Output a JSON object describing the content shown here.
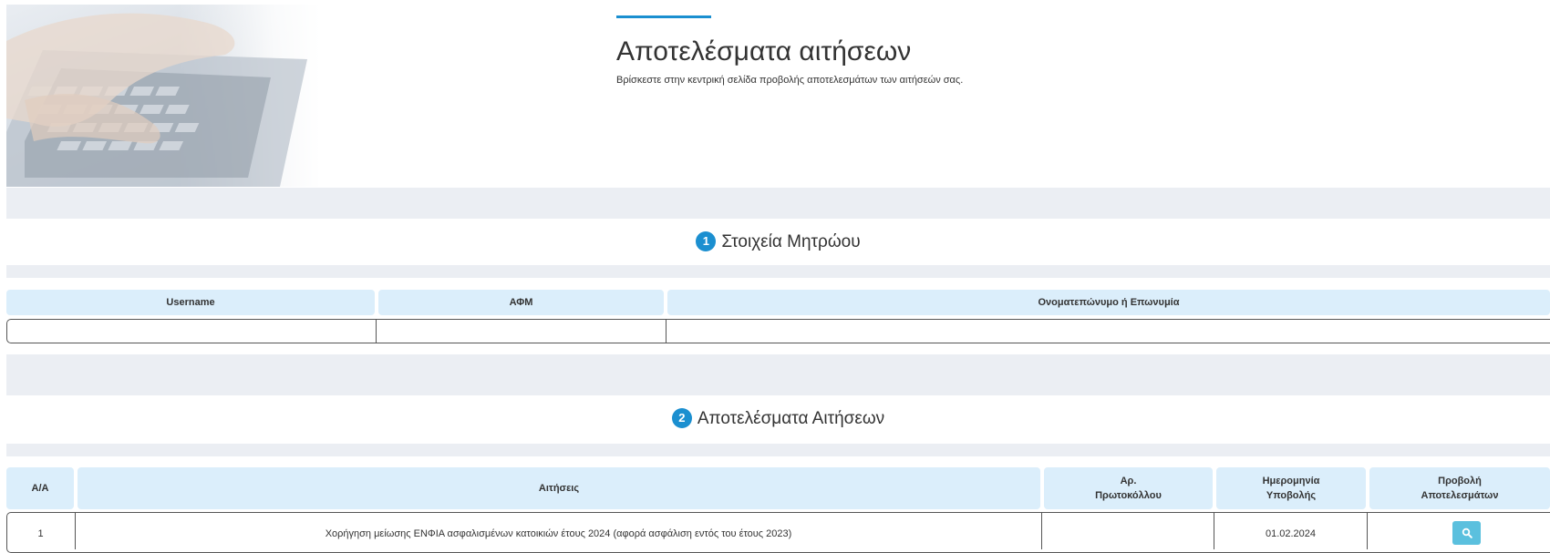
{
  "header": {
    "title": "Αποτελέσματα αιτήσεων",
    "subtitle": "Βρίσκεστε στην κεντρική σελίδα προβολής αποτελεσμάτων των αιτήσεών σας."
  },
  "registry": {
    "step": "1",
    "heading": "Στοιχεία Μητρώου",
    "columns": [
      "Username",
      "ΑΦΜ",
      "Ονοματεπώνυμο ή Επωνυμία"
    ],
    "row": [
      "",
      "",
      ""
    ]
  },
  "results": {
    "step": "2",
    "heading": "Αποτελέσματα Αιτήσεων",
    "columns": {
      "aa": "Α/Α",
      "requests": "Αιτήσεις",
      "protocol_line1": "Αρ.",
      "protocol_line2": "Πρωτοκόλλου",
      "date_line1": "Ημερομηνία",
      "date_line2": "Υποβολής",
      "view_line1": "Προβολή",
      "view_line2": "Αποτελεσμάτων"
    },
    "rows": [
      {
        "aa": "1",
        "request": "Χορήγηση μείωσης ΕΝΦΙΑ ασφαλισμένων κατοικιών έτους 2024 (αφορά ασφάλιση εντός του έτους 2023)",
        "protocol": "",
        "date": "01.02.2024",
        "view_icon": "search-icon"
      }
    ]
  },
  "colors": {
    "accent": "#1b8fd0",
    "header_cell": "#dbeefb",
    "band": "#ebeef3",
    "view_button": "#5bc0de"
  }
}
